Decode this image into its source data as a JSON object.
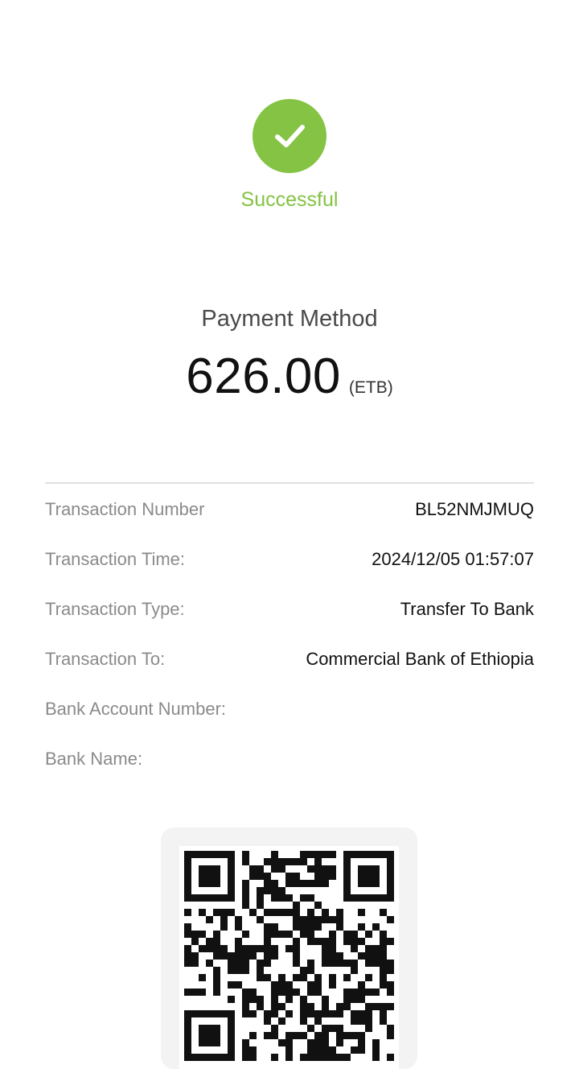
{
  "status": {
    "text": "Successful",
    "icon": "checkmark-icon",
    "color": "#84c343"
  },
  "payment": {
    "title": "Payment Method",
    "amount": "626.00",
    "currency": "(ETB)"
  },
  "details": [
    {
      "label": "Transaction Number",
      "value": "BL52NMJMUQ"
    },
    {
      "label": "Transaction Time:",
      "value": "2024/12/05 01:57:07"
    },
    {
      "label": "Transaction Type:",
      "value": "Transfer To Bank"
    },
    {
      "label": "Transaction To:",
      "value": "Commercial Bank of Ethiopia"
    },
    {
      "label": "Bank Account Number:",
      "value": ""
    },
    {
      "label": "Bank Name:",
      "value": ""
    }
  ],
  "qr": {
    "icon": "qr-code-icon"
  }
}
